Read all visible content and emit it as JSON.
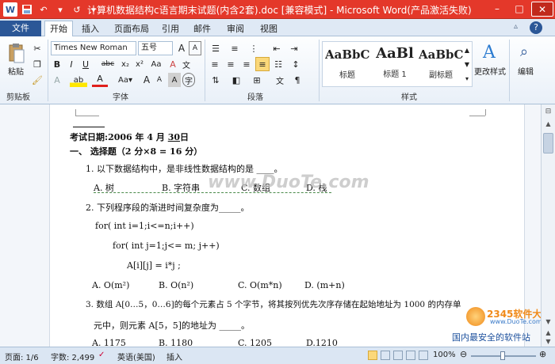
{
  "window": {
    "title": "计算机数据结构c语言期末试题(内含2套).doc [兼容模式] - Microsoft Word(产品激活失败)",
    "title_bar_color": "#e4382a",
    "qa_icons": [
      "word-logo-icon",
      "save-icon",
      "undo-icon",
      "redo-icon",
      "customize-icon"
    ],
    "minimize": "–",
    "maximize": "□",
    "close": "✕"
  },
  "tabs": {
    "file": "文件",
    "home": "开始",
    "insert": "插入",
    "layout": "页面布局",
    "references": "引用",
    "mailings": "邮件",
    "review": "审阅",
    "view": "视图"
  },
  "ribbon": {
    "clipboard": {
      "paste": "粘贴",
      "label": "剪贴板"
    },
    "font": {
      "name": "Times New Roman",
      "size": "五号",
      "label": "字体",
      "bold": "B",
      "italic": "I",
      "underline": "U",
      "strike": "abc",
      "sub": "x₂",
      "sup": "x²",
      "change_case": "Aa",
      "grow": "A",
      "shrink": "A",
      "clear": "A",
      "phonetic": "文",
      "enclose": "字",
      "border": "A",
      "font_color": "A",
      "highlight": "ab",
      "char_shade": "A"
    },
    "paragraph": {
      "label": "段落"
    },
    "styles": {
      "label": "样式",
      "items": [
        {
          "sample": "AaBbC",
          "name": "标题"
        },
        {
          "sample": "AaBl",
          "name": "标题 1"
        },
        {
          "sample": "AaBbC",
          "name": "副标题"
        }
      ],
      "change_styles": "更改样式"
    },
    "editing": {
      "label": "编辑"
    }
  },
  "document": {
    "exam_date_label": "考试日期:",
    "exam_date_year": "2006",
    "exam_date_year_unit": "年",
    "exam_date_month": "4",
    "exam_date_month_unit": "月",
    "exam_date_day": "30",
    "exam_date_day_unit": "日",
    "section1": "一、        选择题（2 分×8 = 16 分）",
    "q1": "1.  以下数据结构中，是非线性数据结构的是 ____。",
    "q1_options": [
      "A.  树",
      "B.  字符串",
      "C.  数组",
      "D.  栈"
    ],
    "q2": "2.  下列程序段的渐进时间复杂度为_____。",
    "code1": "for( int i=1;i<=n;i++)",
    "code2": "for( int j=1;j<= m; j++)",
    "code3": "A[i][j] = i*j ;",
    "q2_options": [
      "A. O(m²)",
      "B. O(n²)",
      "C. O(m*n)",
      "D.  (m+n)"
    ],
    "q3_line1": "3.  数组 A[0…5，0…6]的每个元素占 5 个字节，将其按列优先次序存储在起始地址为 1000 的内存单",
    "q3_line2": "元中，则元素 A[5，5]的地址为 _____。",
    "q3_options": [
      "A. 1175",
      "B. 1180",
      "C. 1205",
      "D.1210"
    ]
  },
  "watermark": {
    "site": "www.DuoTe.com",
    "corner_site": "2345软件大全",
    "corner_url": "www.DuoTe.com",
    "corner_slogan": "国内最安全的软件站"
  },
  "status": {
    "page": "页面: 1/6",
    "words": "字数: 2,499",
    "language": "英语(美国)",
    "insert_mode": "插入",
    "zoom": "100%"
  }
}
